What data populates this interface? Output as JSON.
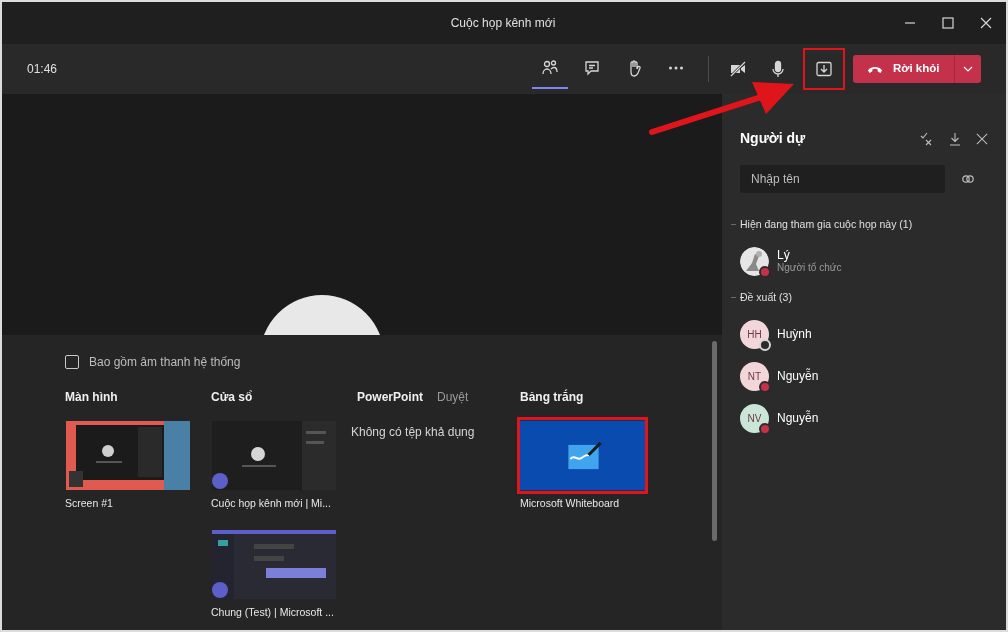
{
  "window": {
    "title": "Cuộc họp kênh mới"
  },
  "toolbar": {
    "timer": "01:46",
    "buttons": [
      {
        "kind": "people",
        "selected": true
      },
      {
        "kind": "chat",
        "selected": false
      },
      {
        "kind": "hand",
        "selected": false
      },
      {
        "kind": "more",
        "selected": false
      }
    ],
    "media": [
      {
        "kind": "camera-off",
        "highlighted": false
      },
      {
        "kind": "mic",
        "highlighted": false
      },
      {
        "kind": "share",
        "highlighted": true
      }
    ],
    "leave_label": "Rời khỏi"
  },
  "people_panel": {
    "title": "Người dự",
    "search": {
      "placeholder": "Nhập tên"
    },
    "sections": [
      {
        "label": "Hiện đang tham gia cuộc họp này (1)",
        "people": [
          {
            "kind": "picture",
            "name": "Lý",
            "role": "Người tổ chức",
            "busy": true
          }
        ]
      },
      {
        "label": "Đề xuất (3)",
        "people": [
          {
            "kind": "initials",
            "initials": "HH",
            "name": "Huỳnh",
            "color": "#f3d6da",
            "busy": false
          },
          {
            "kind": "initials",
            "initials": "NT",
            "name": "Nguyễn",
            "color": "#f3d6da",
            "busy": true
          },
          {
            "kind": "initials",
            "initials": "NV",
            "name": "Nguyễn",
            "color": "#c9e6d6",
            "busy": true
          }
        ]
      }
    ]
  },
  "share_tray": {
    "system_audio": {
      "label": "Bao gồm âm thanh hệ thống",
      "checked": false
    },
    "columns": [
      {
        "title": "Màn hình",
        "items": [
          {
            "kind": "screen",
            "label": "Screen #1",
            "highlighted": false
          }
        ]
      },
      {
        "title": "Cửa sổ",
        "items": [
          {
            "kind": "meeting",
            "label": "Cuộc họp kênh mới | Mi...",
            "highlighted": false
          },
          {
            "kind": "chat",
            "label": "Chung (Test) | Microsoft ...",
            "highlighted": false
          }
        ]
      },
      {
        "title": "PowerPoint",
        "browse": "Duyệt",
        "empty": "Không có tệp khả dụng"
      },
      {
        "title": "Bảng trắng",
        "items": [
          {
            "kind": "whiteboard",
            "label": "Microsoft Whiteboard",
            "highlighted": true
          }
        ]
      }
    ]
  }
}
